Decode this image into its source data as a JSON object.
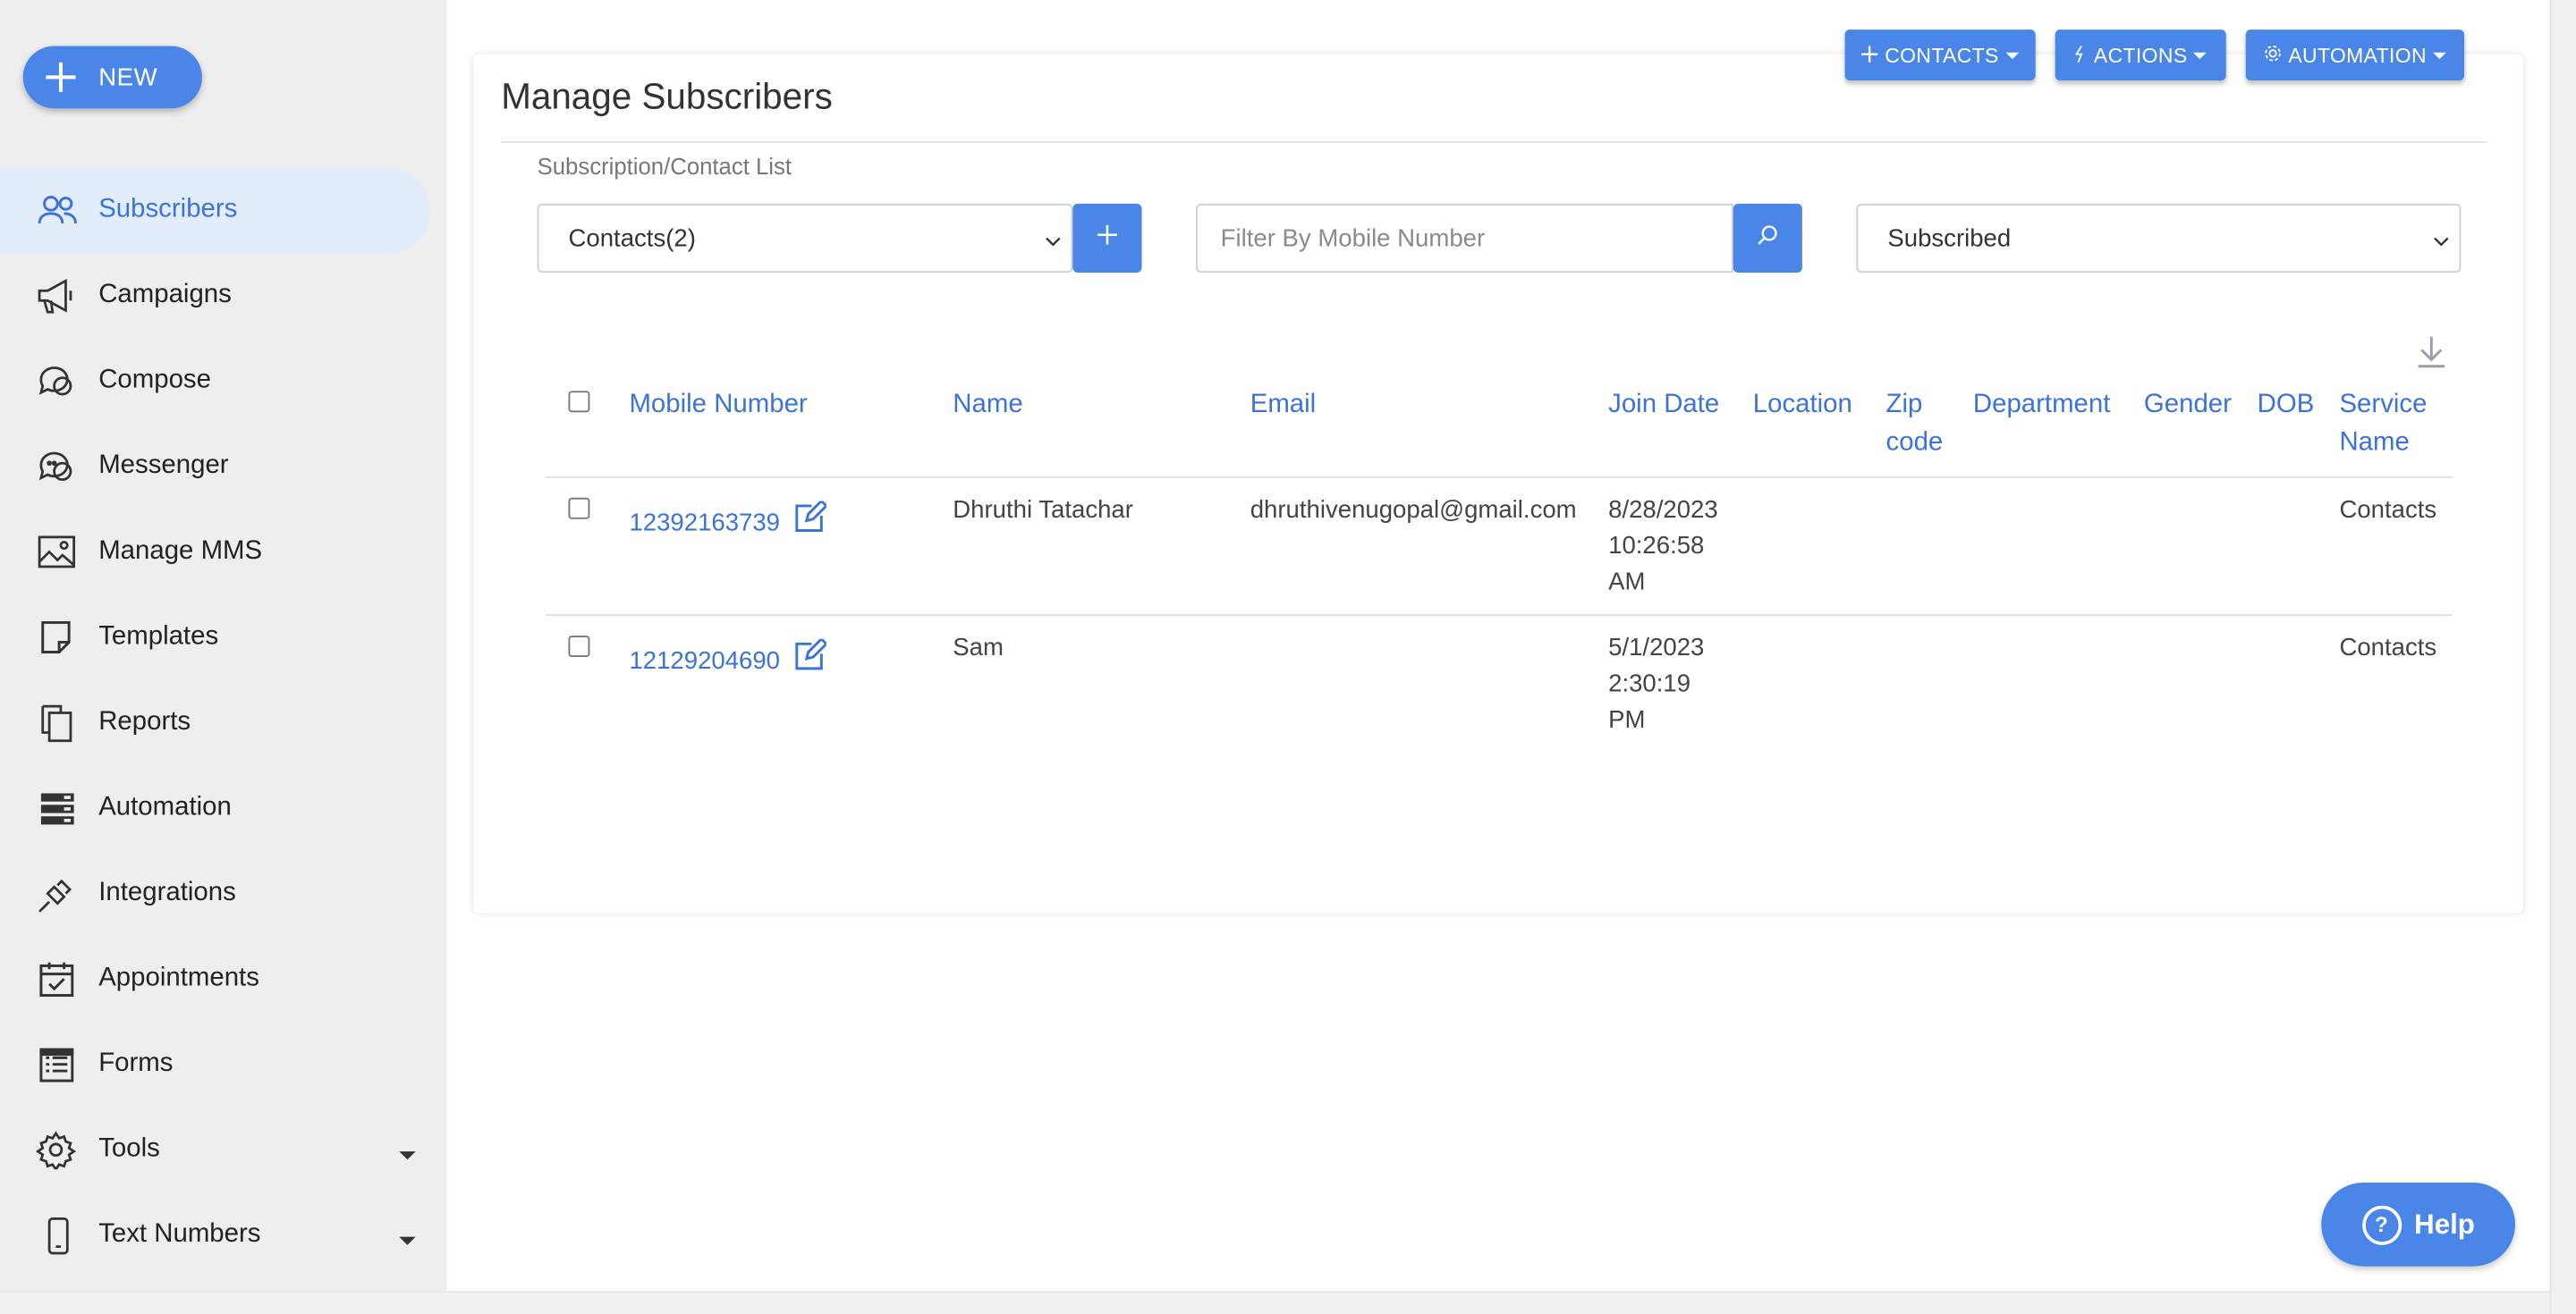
{
  "sidebar": {
    "new_label": "NEW",
    "items": [
      {
        "label": "Subscribers",
        "icon": "users-icon",
        "active": true
      },
      {
        "label": "Campaigns",
        "icon": "megaphone-icon"
      },
      {
        "label": "Compose",
        "icon": "chat-icon"
      },
      {
        "label": "Messenger",
        "icon": "messenger-icon"
      },
      {
        "label": "Manage MMS",
        "icon": "image-icon"
      },
      {
        "label": "Templates",
        "icon": "note-icon"
      },
      {
        "label": "Reports",
        "icon": "copy-icon"
      },
      {
        "label": "Automation",
        "icon": "server-icon"
      },
      {
        "label": "Integrations",
        "icon": "plug-icon"
      },
      {
        "label": "Appointments",
        "icon": "calendar-check-icon"
      },
      {
        "label": "Forms",
        "icon": "form-list-icon"
      },
      {
        "label": "Tools",
        "icon": "gear-icon",
        "has_submenu": true
      },
      {
        "label": "Text Numbers",
        "icon": "phone-icon",
        "has_submenu": true
      }
    ]
  },
  "toolbar": {
    "contacts_label": "CONTACTS",
    "actions_label": "ACTIONS",
    "automation_label": "AUTOMATION"
  },
  "main": {
    "title": "Manage Subscribers",
    "list_label": "Subscription/Contact List",
    "list_select_value": "Contacts(2)",
    "filter_placeholder": "Filter By Mobile Number",
    "status_select_value": "Subscribed"
  },
  "table": {
    "headers": {
      "mobile": "Mobile Number",
      "name": "Name",
      "email": "Email",
      "join_date": "Join Date",
      "location": "Location",
      "zip_line1": "Zip",
      "zip_line2": "code",
      "department": "Department",
      "gender": "Gender",
      "dob": "DOB",
      "service_line1": "Service",
      "service_line2": "Name"
    },
    "rows": [
      {
        "mobile": "12392163739",
        "name": "Dhruthi Tatachar",
        "email": "dhruthivenugopal@gmail.com",
        "join_date_1": "8/28/2023",
        "join_date_2": "10:26:58",
        "join_date_3": "AM",
        "service": "Contacts"
      },
      {
        "mobile": "12129204690",
        "name": "Sam",
        "email": "",
        "join_date_1": "5/1/2023",
        "join_date_2": "2:30:19",
        "join_date_3": "PM",
        "service": "Contacts"
      }
    ]
  },
  "help_label": "Help",
  "colors": {
    "accent": "#4a86e8",
    "link": "#3b73d9",
    "sidebar_bg": "#eeeeee",
    "active_bg": "#e3ecfb"
  }
}
